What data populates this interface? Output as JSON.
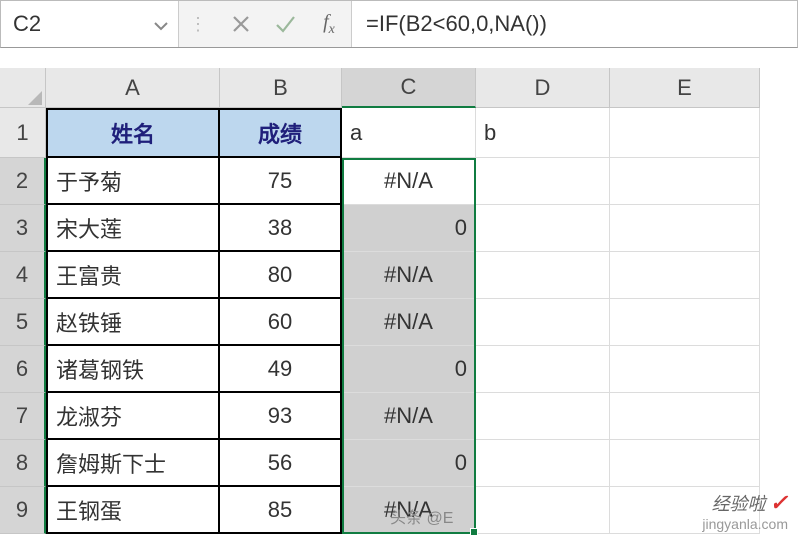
{
  "name_box": "C2",
  "formula": "=IF(B2<60,0,NA())",
  "columns": [
    "A",
    "B",
    "C",
    "D",
    "E"
  ],
  "row_numbers": [
    "1",
    "2",
    "3",
    "4",
    "5",
    "6",
    "7",
    "8",
    "9"
  ],
  "header": {
    "a": "姓名",
    "b": "成绩"
  },
  "row1_extra": {
    "c": "a",
    "d": "b"
  },
  "data": [
    {
      "name": "于予菊",
      "score": "75",
      "c": "#N/A"
    },
    {
      "name": "宋大莲",
      "score": "38",
      "c": "0"
    },
    {
      "name": "王富贵",
      "score": "80",
      "c": "#N/A"
    },
    {
      "name": "赵铁锤",
      "score": "60",
      "c": "#N/A"
    },
    {
      "name": "诸葛钢铁",
      "score": "49",
      "c": "0"
    },
    {
      "name": "龙淑芬",
      "score": "93",
      "c": "#N/A"
    },
    {
      "name": "詹姆斯下士",
      "score": "56",
      "c": "0"
    },
    {
      "name": "王钢蛋",
      "score": "85",
      "c": "#N/A"
    }
  ],
  "watermark": {
    "brand": "经验啦",
    "url": "jingyanla.com",
    "toutiao": "头条 @E"
  },
  "chart_data": {
    "type": "table",
    "columns": [
      "姓名",
      "成绩",
      "a",
      "b"
    ],
    "rows": [
      [
        "于予菊",
        75,
        "#N/A",
        null
      ],
      [
        "宋大莲",
        38,
        0,
        null
      ],
      [
        "王富贵",
        80,
        "#N/A",
        null
      ],
      [
        "赵铁锤",
        60,
        "#N/A",
        null
      ],
      [
        "诸葛钢铁",
        49,
        0,
        null
      ],
      [
        "龙淑芬",
        93,
        "#N/A",
        null
      ],
      [
        "詹姆斯下士",
        56,
        0,
        null
      ],
      [
        "王钢蛋",
        85,
        "#N/A",
        null
      ]
    ],
    "formula_C": "=IF(B2<60,0,NA())"
  }
}
